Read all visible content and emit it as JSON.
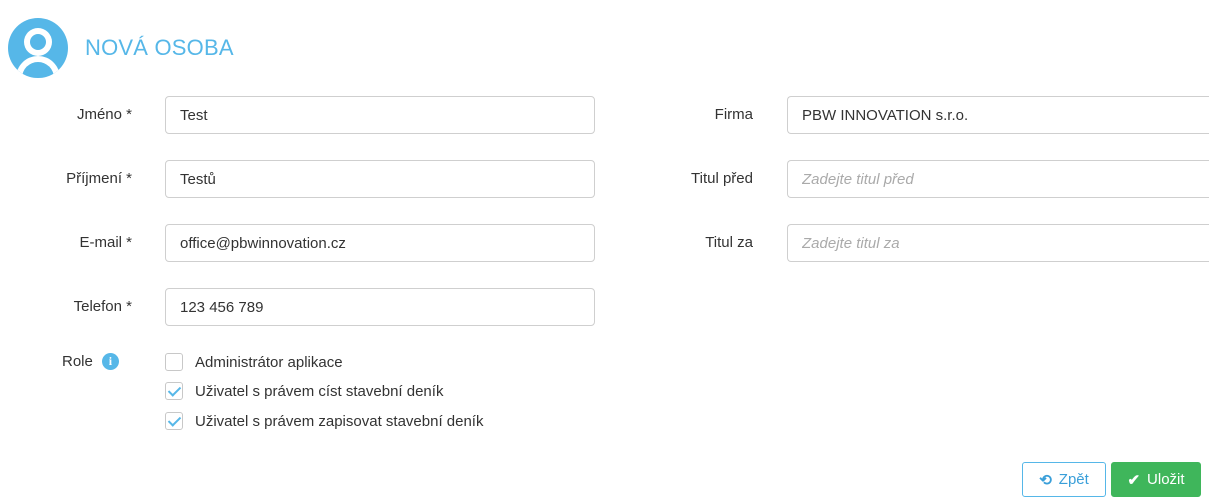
{
  "header": {
    "title": "NOVÁ OSOBA",
    "icon": "user-avatar-icon"
  },
  "form": {
    "first_name": {
      "label": "Jméno *",
      "value": "Test"
    },
    "last_name": {
      "label": "Příjmení *",
      "value": "Testů"
    },
    "email": {
      "label": "E-mail *",
      "value": "office@pbwinnovation.cz"
    },
    "phone": {
      "label": "Telefon *",
      "value": "123 456 789"
    },
    "company": {
      "label": "Firma",
      "value": "PBW INNOVATION s.r.o."
    },
    "title_before": {
      "label": "Titul před",
      "value": "",
      "placeholder": "Zadejte titul před"
    },
    "title_after": {
      "label": "Titul za",
      "value": "",
      "placeholder": "Zadejte titul za"
    }
  },
  "roles": {
    "label": "Role",
    "info_icon": "i",
    "items": [
      {
        "label": "Administrátor aplikace",
        "checked": false
      },
      {
        "label": "Uživatel s právem císt stavební deník",
        "checked": true
      },
      {
        "label": "Uživatel s právem zapisovat stavební deník",
        "checked": true
      }
    ]
  },
  "actions": {
    "back_label": "Zpět",
    "back_icon": "⟲",
    "save_label": "Uložit",
    "save_icon": "✔"
  },
  "colors": {
    "accent": "#56b7e8",
    "success": "#3fb65b"
  }
}
